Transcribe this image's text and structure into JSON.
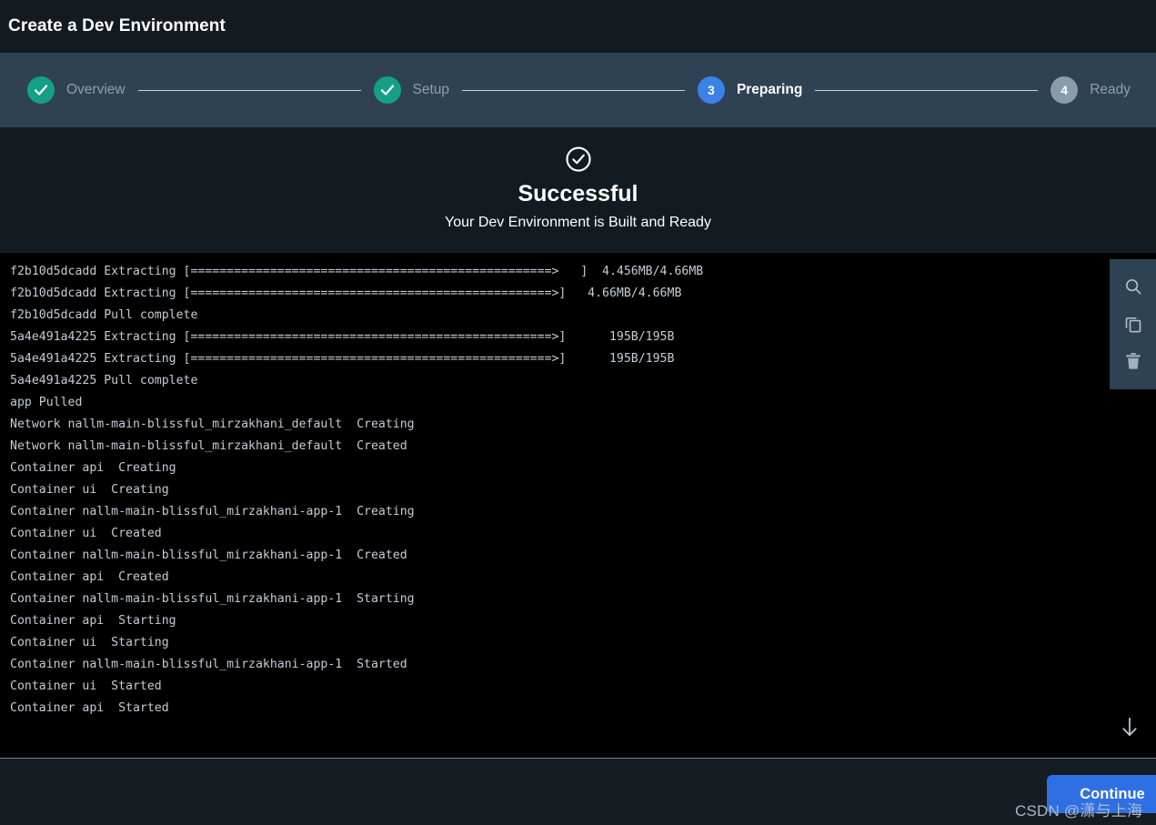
{
  "window": {
    "title": "Create a Dev Environment"
  },
  "stepper": {
    "steps": [
      {
        "index": "1",
        "label": "Overview",
        "state": "done",
        "icon": "check-icon"
      },
      {
        "index": "2",
        "label": "Setup",
        "state": "done",
        "icon": "check-icon"
      },
      {
        "index": "3",
        "label": "Preparing",
        "state": "active",
        "icon": ""
      },
      {
        "index": "4",
        "label": "Ready",
        "state": "pending",
        "icon": ""
      }
    ]
  },
  "status": {
    "icon": "check-circle-icon",
    "title": "Successful",
    "subtitle": "Your Dev Environment is Built and Ready"
  },
  "terminal": {
    "tools": [
      {
        "name": "search-icon",
        "label": "Search"
      },
      {
        "name": "copy-icon",
        "label": "Copy"
      },
      {
        "name": "trash-icon",
        "label": "Delete"
      }
    ],
    "scroll_to_bottom_icon": "arrow-down-icon",
    "lines": [
      "f2b10d5dcadd Extracting [==================================================>   ]  4.456MB/4.66MB",
      "f2b10d5dcadd Extracting [==================================================>]   4.66MB/4.66MB",
      "f2b10d5dcadd Pull complete",
      "5a4e491a4225 Extracting [==================================================>]      195B/195B",
      "5a4e491a4225 Extracting [==================================================>]      195B/195B",
      "5a4e491a4225 Pull complete",
      "app Pulled",
      "Network nallm-main-blissful_mirzakhani_default  Creating",
      "Network nallm-main-blissful_mirzakhani_default  Created",
      "Container api  Creating",
      "Container ui  Creating",
      "Container nallm-main-blissful_mirzakhani-app-1  Creating",
      "Container ui  Created",
      "Container nallm-main-blissful_mirzakhani-app-1  Created",
      "Container api  Created",
      "Container nallm-main-blissful_mirzakhani-app-1  Starting",
      "Container api  Starting",
      "Container ui  Starting",
      "Container nallm-main-blissful_mirzakhani-app-1  Started",
      "Container ui  Started",
      "Container api  Started"
    ]
  },
  "footer": {
    "continue_label": "Continue"
  },
  "watermark": {
    "text": "CSDN @潇与上海"
  },
  "colors": {
    "step_done": "#14a085",
    "step_active": "#3b82e8",
    "step_pending": "#8a9bab",
    "accent_button": "#2f6fe4",
    "terminal_bg": "#000000",
    "terminal_text": "#c3ccd6",
    "stepper_bg": "#2f4254",
    "titlebar_bg": "#141b20"
  }
}
